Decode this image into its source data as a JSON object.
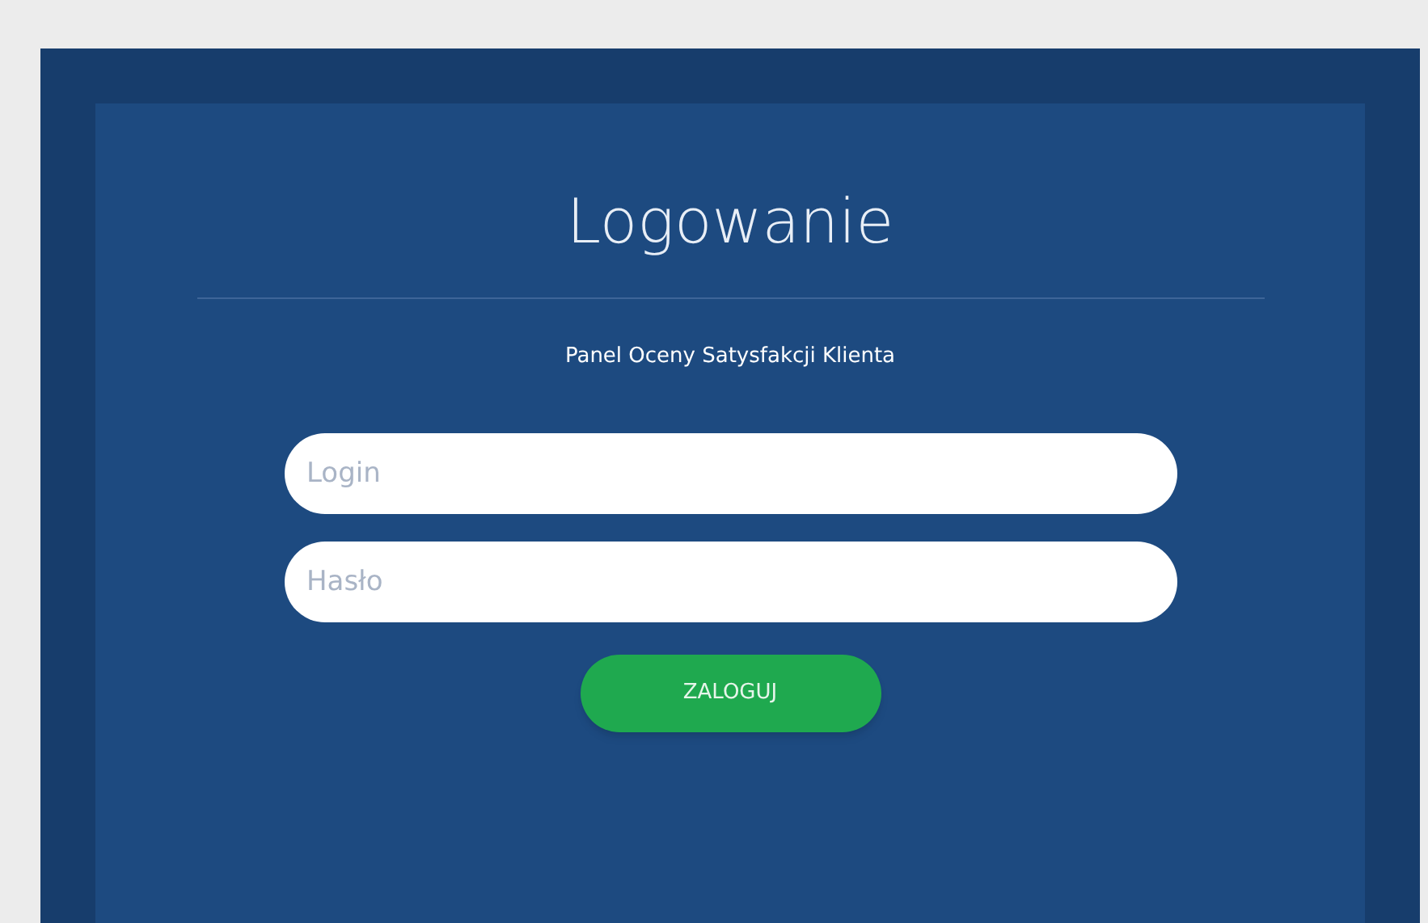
{
  "title": "Logowanie",
  "subtitle": "Panel Oceny Satysfakcji Klienta",
  "fields": [
    {
      "placeholder": "Login"
    },
    {
      "placeholder": "Hasło"
    }
  ],
  "button": "ZALOGUJ"
}
